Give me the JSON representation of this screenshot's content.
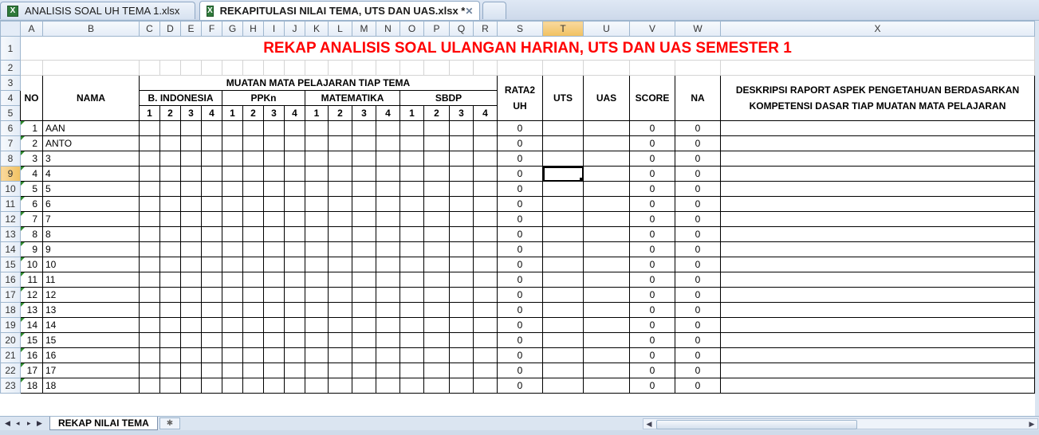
{
  "tabs": [
    {
      "label": "ANALISIS SOAL UH TEMA 1.xlsx",
      "active": false
    },
    {
      "label": "REKAPITULASI NILAI TEMA, UTS DAN UAS.xlsx *",
      "active": true
    }
  ],
  "icons": {
    "excel": "excel-file-icon",
    "close": "close-icon"
  },
  "columns": [
    "A",
    "B",
    "C",
    "D",
    "E",
    "F",
    "G",
    "H",
    "I",
    "J",
    "K",
    "L",
    "M",
    "N",
    "O",
    "P",
    "Q",
    "R",
    "S",
    "T",
    "U",
    "V",
    "W",
    "X"
  ],
  "selected_column": "T",
  "selected_row": 9,
  "sheet": {
    "title": "REKAP ANALISIS SOAL ULANGAN HARIAN, UTS DAN UAS SEMESTER 1",
    "no_label": "NO",
    "nama_label": "NAMA",
    "muatan_label": "MUATAN MATA PELAJARAN TIAP TEMA",
    "subjects": [
      "B. INDONESIA",
      "PPKn",
      "MATEMATIKA",
      "SBDP"
    ],
    "tema_numbers": [
      "1",
      "2",
      "3",
      "4"
    ],
    "rata2_label": "RATA2 UH",
    "uts_label": "UTS",
    "uas_label": "UAS",
    "score_label": "SCORE",
    "na_label": "NA",
    "deskripsi_label": "DESKRIPSI RAPORT ASPEK PENGETAHUAN BERDASARKAN KOMPETENSI DASAR TIAP MUATAN MATA PELAJARAN",
    "students": [
      {
        "row": "6",
        "no": "1",
        "nama": "AAN",
        "rata2": "0",
        "score": "0",
        "na": "0"
      },
      {
        "row": "7",
        "no": "2",
        "nama": "ANTO",
        "rata2": "0",
        "score": "0",
        "na": "0"
      },
      {
        "row": "8",
        "no": "3",
        "nama": "3",
        "rata2": "0",
        "score": "0",
        "na": "0"
      },
      {
        "row": "9",
        "no": "4",
        "nama": "4",
        "rata2": "0",
        "score": "0",
        "na": "0"
      },
      {
        "row": "10",
        "no": "5",
        "nama": "5",
        "rata2": "0",
        "score": "0",
        "na": "0"
      },
      {
        "row": "11",
        "no": "6",
        "nama": "6",
        "rata2": "0",
        "score": "0",
        "na": "0"
      },
      {
        "row": "12",
        "no": "7",
        "nama": "7",
        "rata2": "0",
        "score": "0",
        "na": "0"
      },
      {
        "row": "13",
        "no": "8",
        "nama": "8",
        "rata2": "0",
        "score": "0",
        "na": "0"
      },
      {
        "row": "14",
        "no": "9",
        "nama": "9",
        "rata2": "0",
        "score": "0",
        "na": "0"
      },
      {
        "row": "15",
        "no": "10",
        "nama": "10",
        "rata2": "0",
        "score": "0",
        "na": "0"
      },
      {
        "row": "16",
        "no": "11",
        "nama": "11",
        "rata2": "0",
        "score": "0",
        "na": "0"
      },
      {
        "row": "17",
        "no": "12",
        "nama": "12",
        "rata2": "0",
        "score": "0",
        "na": "0"
      },
      {
        "row": "18",
        "no": "13",
        "nama": "13",
        "rata2": "0",
        "score": "0",
        "na": "0"
      },
      {
        "row": "19",
        "no": "14",
        "nama": "14",
        "rata2": "0",
        "score": "0",
        "na": "0"
      },
      {
        "row": "20",
        "no": "15",
        "nama": "15",
        "rata2": "0",
        "score": "0",
        "na": "0"
      },
      {
        "row": "21",
        "no": "16",
        "nama": "16",
        "rata2": "0",
        "score": "0",
        "na": "0"
      },
      {
        "row": "22",
        "no": "17",
        "nama": "17",
        "rata2": "0",
        "score": "0",
        "na": "0"
      },
      {
        "row": "23",
        "no": "18",
        "nama": "18",
        "rata2": "0",
        "score": "0",
        "na": "0"
      }
    ]
  },
  "sheet_tabs": [
    {
      "label": "REKAP NILAI TEMA",
      "active": true
    }
  ],
  "colors": {
    "title": "#ff0000",
    "selection": "#f1c15f",
    "header_bg": "#e4ecf7"
  }
}
